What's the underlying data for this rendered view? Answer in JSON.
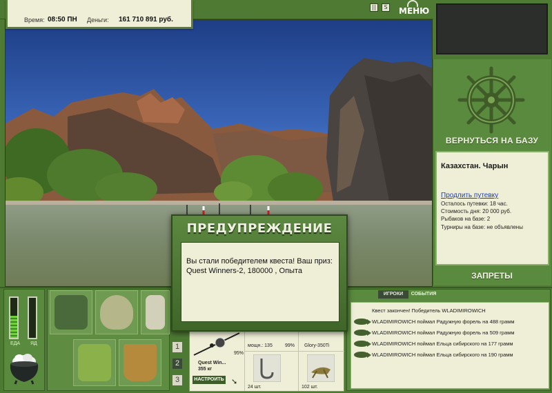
{
  "topbar": {
    "time_label": "Время:",
    "time_value": "08:50 ПН",
    "money_label": "Деньги:",
    "money_value": "161 710 891 руб.",
    "pause_glyph": "||",
    "sound_glyph": "S",
    "menu_label": "МЕНЮ"
  },
  "right_panel": {
    "back_label": "ВЕРНУТЬСЯ НА БАЗУ",
    "location": "Казахстан. Чарын",
    "extend_link": "Продлить путевку",
    "trip_left": "Осталось путевки: 18 час.",
    "day_cost": "Стоимость дня: 20 000 руб.",
    "anglers": "Рыбаков на базе: 2",
    "tournaments": "Турниры на базе: не объявлены",
    "bans_label": "ЗАПРЕТЫ"
  },
  "status": {
    "food_label": "ЕДА",
    "poison_label": "ЯД",
    "food_level": 0.55,
    "poison_level": 0.0
  },
  "inventory": {
    "page_buttons": [
      "1",
      "2",
      "3"
    ],
    "active_page": "2"
  },
  "tackle": {
    "rig_name": "Quest Win...",
    "rig_weight": "355 кг",
    "percent_left": "95%",
    "power_label": "мощн.: 135",
    "percent_mid": "99%",
    "line_name": "Glory-350Ti",
    "hooks_count": "24 шт.",
    "bait_count": "102 шт.",
    "setup_label": "НАСТРОИТЬ"
  },
  "events": {
    "tab_players": "ИГРОКИ",
    "tab_events": "СОБЫТИЯ",
    "rows": [
      {
        "text": "Квест закончен! Победитель WLADIMIROWICH",
        "fish": false
      },
      {
        "text": "WLADIMIROWICH поймал Радужную форель на 488 грамм",
        "fish": true
      },
      {
        "text": "WLADIMIROWICH поймал Радужную форель на 509 грамм",
        "fish": true
      },
      {
        "text": "WLADIMIROWICH поймал Ельца сибирского на 177 грамм",
        "fish": true
      },
      {
        "text": "WLADIMIROWICH поймал Ельца сибирского на 190 грамм",
        "fish": true
      }
    ]
  },
  "dialog": {
    "title": "ПРЕДУПРЕЖДЕНИЕ",
    "message": "Вы стали победителем квеста! Ваш приз: Quest Winners-2, 180000 , Опыта"
  }
}
